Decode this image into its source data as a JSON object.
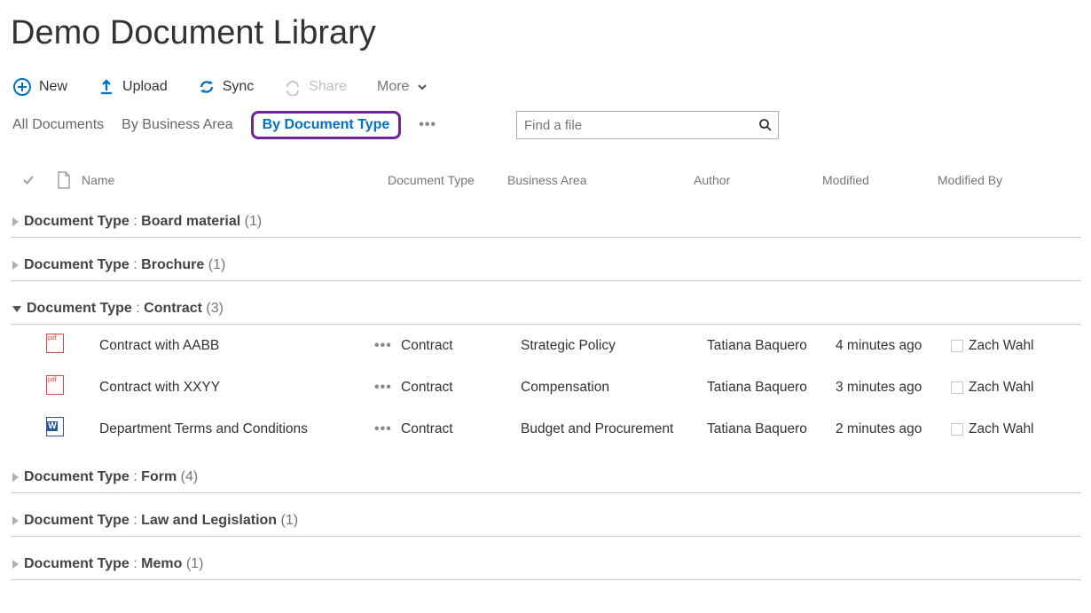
{
  "title": "Demo Document Library",
  "toolbar": {
    "new": "New",
    "upload": "Upload",
    "sync": "Sync",
    "share": "Share",
    "more": "More"
  },
  "views": {
    "all": "All Documents",
    "byBusinessArea": "By Business Area",
    "byDocType": "By Document Type"
  },
  "search": {
    "placeholder": "Find a file"
  },
  "columns": {
    "name": "Name",
    "docType": "Document Type",
    "businessArea": "Business Area",
    "author": "Author",
    "modified": "Modified",
    "modifiedBy": "Modified By"
  },
  "groupLabel": "Document Type",
  "groups": [
    {
      "value": "Board material",
      "count": "(1)",
      "open": false
    },
    {
      "value": "Brochure",
      "count": "(1)",
      "open": false
    },
    {
      "value": "Contract",
      "count": "(3)",
      "open": true,
      "rows": [
        {
          "icon": "pdf",
          "name": "Contract with AABB",
          "docType": "Contract",
          "biz": "Strategic Policy",
          "author": "Tatiana Baquero",
          "modified": "4 minutes ago",
          "modifiedBy": "Zach Wahl"
        },
        {
          "icon": "pdf",
          "name": "Contract with XXYY",
          "docType": "Contract",
          "biz": "Compensation",
          "author": "Tatiana Baquero",
          "modified": "3 minutes ago",
          "modifiedBy": "Zach Wahl"
        },
        {
          "icon": "word",
          "name": "Department Terms and Conditions",
          "docType": "Contract",
          "biz": "Budget and Procurement",
          "author": "Tatiana Baquero",
          "modified": "2 minutes ago",
          "modifiedBy": "Zach Wahl"
        }
      ]
    },
    {
      "value": "Form",
      "count": "(4)",
      "open": false
    },
    {
      "value": "Law and Legislation",
      "count": "(1)",
      "open": false
    },
    {
      "value": "Memo",
      "count": "(1)",
      "open": false
    }
  ]
}
